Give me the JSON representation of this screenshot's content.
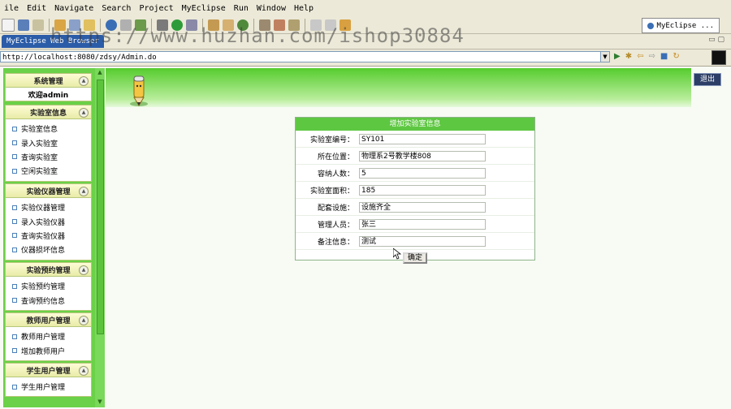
{
  "menu": [
    "ile",
    "Edit",
    "Navigate",
    "Search",
    "Project",
    "MyEclipse",
    "Run",
    "Window",
    "Help"
  ],
  "perspective": "MyEclipse ...",
  "tab_label": "MyEclipse Web Browser",
  "watermark": "https://www.huzhan.com/ishop30884",
  "address": "http://localhost:8080/zdsy/Admin.do",
  "logout_label": "退出",
  "sidebar": {
    "system": {
      "title": "系统管理",
      "welcome": "欢迎admin"
    },
    "sections": [
      {
        "title": "实验室信息",
        "items": [
          "实验室信息",
          "录入实验室",
          "查询实验室",
          "空闲实验室"
        ]
      },
      {
        "title": "实验仪器管理",
        "items": [
          "实验仪器管理",
          "录入实验仪器",
          "查询实验仪器",
          "仪器损坏信息"
        ]
      },
      {
        "title": "实验预约管理",
        "items": [
          "实验预约管理",
          "查询预约信息"
        ]
      },
      {
        "title": "教师用户管理",
        "items": [
          "教师用户管理",
          "增加教师用户"
        ]
      },
      {
        "title": "学生用户管理",
        "items": [
          "学生用户管理"
        ]
      }
    ]
  },
  "form": {
    "title": "增加实验室信息",
    "fields": [
      {
        "label": "实验室编号：",
        "value": "SY101"
      },
      {
        "label": "所在位置：",
        "value": "物理系2号教学楼808"
      },
      {
        "label": "容纳人数：",
        "value": "5"
      },
      {
        "label": "实验室面积：",
        "value": "185"
      },
      {
        "label": "配套设施：",
        "value": "设施齐全"
      },
      {
        "label": "管理人员：",
        "value": "张三"
      },
      {
        "label": "备注信息：",
        "value": "测试"
      }
    ],
    "submit_label": "确定"
  },
  "colors": {
    "sidebar": "#6ad148",
    "header": "#5ec742",
    "banner": "#56cc2e"
  }
}
